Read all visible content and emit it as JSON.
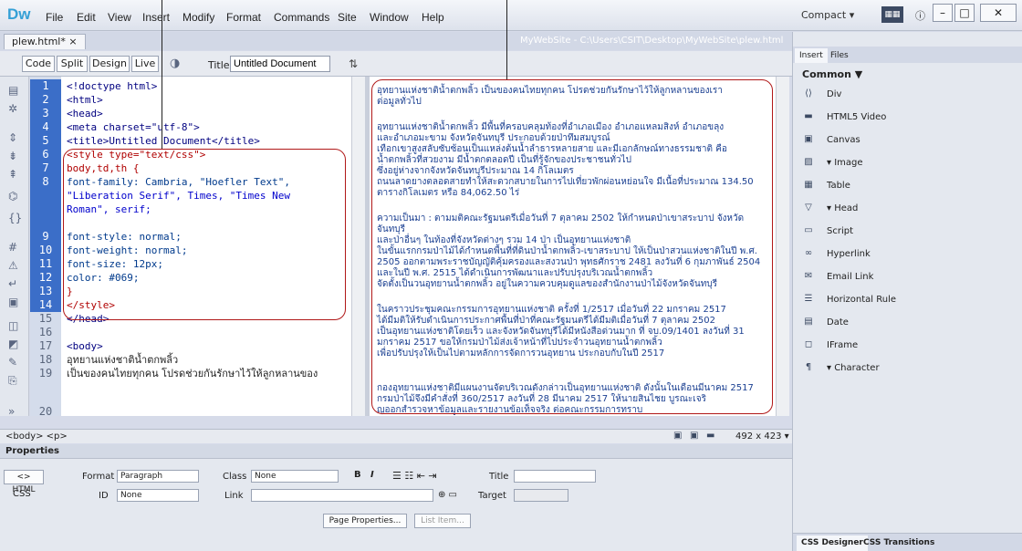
{
  "app": {
    "logo": "Dw",
    "workspace": "Compact ▾",
    "grid_icon": "grid-icon"
  },
  "menu": [
    "File",
    "Edit",
    "View",
    "Insert",
    "Modify",
    "Format",
    "Commands",
    "Site",
    "Window",
    "Help"
  ],
  "window_buttons": [
    "–",
    "□",
    "✕"
  ],
  "doc_tab": {
    "label": "plew.html* ×"
  },
  "doc_path": "MyWebSite - C:\\Users\\CSIT\\Desktop\\MyWebSite\\plew.html",
  "view_buttons": [
    "Code",
    "Split",
    "Design",
    "Live"
  ],
  "title_label": "Title:",
  "title_value": "Untitled Document",
  "line_numbers": [
    "1",
    "2",
    "3",
    "4",
    "5",
    "6",
    "7",
    "8",
    "",
    "",
    "9",
    "10",
    "11",
    "12",
    "13",
    "14",
    "15",
    "16",
    "17",
    "18",
    "19",
    "",
    "20"
  ],
  "code_lines": [
    "<!doctype html>",
    "<html>",
    "<head>",
    "<meta charset=\"utf-8\">",
    "<title>Untitled Document</title>",
    "<style type=\"text/css\">",
    "body,td,th {",
    "    font-family: Cambria, \"Hoefler Text\",",
    "\"Liberation Serif\", Times, \"Times New",
    "Roman\", serif;",
    "    font-style: normal;",
    "    font-weight: normal;",
    "    font-size: 12px;",
    "    color: #069;",
    "}",
    "</style>",
    "</head>",
    "",
    "<body>",
    "อุทยานแห่งชาติน้ำตกพลิ้ว",
    "เป็นของคนไทยทุกคน  โปรดช่วยกันรักษาไว้ให้ลูกหลานของ"
  ],
  "design_paragraphs": [
    [
      "อุทยานแห่งชาติน้ำตกพลิ้ว เป็นของคนไทยทุกคน โปรดช่วยกันรักษาไว้ให้ลูกหลานของเรา",
      "ต่อมูลทั่วไป"
    ],
    [
      "อุทยานแห่งชาติน้ำตกพลิ้ว มีพื้นที่ครอบคลุมท้องที่อำเภอเมือง อำเภอแหลมสิงห์ อำเภอขลุง",
      "และอำเภอมะขาม จังหวัดจันทบุรี ประกอบด้วยป่าทึมสมบูรณ์",
      "เทือกเขาสูงสลับซับซ้อนเป็นแหล่งต้นน้ำลำธารหลายสาย และมีเอกลักษณ์ทางธรรมชาติ คือ",
      "น้ำตกพลิ้วที่สวยงาม มีน้ำตกตลอดปี เป็นที่รู้จักของประชาชนทั่วไป",
      "ซึ่งอยู่ห่างจากจังหวัดจันทบุรีประมาณ 14 กิโลเมตร",
      "ถนนลาดยางตลอดสายทำให้สะดวกสบายในการไปเที่ยวพักผ่อนหย่อนใจ มีเนื้อที่ประมาณ 134.50",
      "ตารางกิโลเมตร หรือ 84,062.50 ไร่"
    ],
    [
      "ความเป็นมา : ตามมติคณะรัฐมนตรีเมื่อวันที่ 7 ตุลาคม 2502 ให้กำหนดป่าเขาสระบาป จังหวัดจันทบุรี",
      "และป่าอื่นๆ ในท้องที่จังหวัดต่างๆ รวม 14 ป่า เป็นอุทยานแห่งชาติ",
      "ในขั้นแรกกรมป่าไม้ได้กำหนดพื้นที่ที่ดินป่าน้ำตกพลิ้ว-เขาสระบาป ให้เป็นป่าสวนแห่งชาติในปี พ.ศ.",
      "2505 ออกตามพระราชบัญญัติคุ้มครองและสงวนป่า พุทธศักราช 2481 ลงวันที่ 6 กุมภาพันธ์ 2504",
      "และในปี พ.ศ. 2515 ได้ดำเนินการพัฒนาและปรับปรุงบริเวณน้ำตกพลิ้ว",
      "จัดตั้งเป็นวนอุทยานน้ำตกพลิ้ว อยู่ในความควบคุมดูแลของสำนักงานป่าไม้จังหวัดจันทบุรี"
    ],
    [
      "ในคราวประชุมคณะกรรมการอุทยานแห่งชาติ ครั้งที่ 1/2517 เมื่อวันที่ 22 มกราคม 2517",
      "ได้มีมติให้รับดำเนินการประกาศพื้นที่ป่าที่คณะรัฐมนตรีได้มีมติเมื่อวันที่ 7 ตุลาคม 2502",
      "เป็นอุทยานแห่งชาติโดยเร็ว และจังหวัดจันทบุรีได้มีหนังสือด่วนมาก ที่ จบ.09/1401 ลงวันที่ 31",
      "มกราคม 2517 ขอให้กรมป่าไม้ส่งเจ้าหน้าที่ไปประจำวนอุทยานน้ำตกพลิ้ว",
      "เพื่อปรับปรุงให้เป็นไปตามหลักการจัดการวนอุทยาน ประกอบกับในปี 2517"
    ],
    [
      "กองอุทยานแห่งชาติมีแผนงานจัดบริเวณดังกล่าวเป็นอุทยานแห่งชาติ ดังนั้นในเดือนมีนาคม 2517",
      "กรมป่าไม้จึงมีคำสั่งที่ 360/2517 ลงวันที่ 28 มีนาคม 2517 ให้นายสินไชย บูรณะเจริ",
      "ญออกสำรวจหาข้อมูลและรายงานข้อเท็จจริง ต่อคณะกรรมการทราบ"
    ]
  ],
  "status": {
    "tag_path": "<body> <p>",
    "size": "492 x 423 ▾"
  },
  "properties": {
    "header": "Properties",
    "html_btn": "<> HTML",
    "css_btn": "CSS",
    "format_label": "Format",
    "format_value": "Paragraph",
    "class_label": "Class",
    "class_value": "None",
    "id_label": "ID",
    "id_value": "None",
    "link_label": "Link",
    "title_label": "Title",
    "target_label": "Target",
    "bold": "B",
    "italic": "I",
    "page_properties": "Page Properties...",
    "list_item": "List Item..."
  },
  "right_panel": {
    "tabs": [
      "Insert",
      "Files"
    ],
    "category": "Common ▼",
    "items": [
      {
        "icon": "div-icon",
        "label": "Div"
      },
      {
        "icon": "video-icon",
        "label": "HTML5 Video"
      },
      {
        "icon": "canvas-icon",
        "label": "Canvas"
      },
      {
        "icon": "image-icon",
        "label": "▾ Image"
      },
      {
        "icon": "table-icon",
        "label": "Table"
      },
      {
        "icon": "head-icon",
        "label": "▾ Head"
      },
      {
        "icon": "script-icon",
        "label": "Script"
      },
      {
        "icon": "hyperlink-icon",
        "label": "Hyperlink"
      },
      {
        "icon": "email-icon",
        "label": "Email Link"
      },
      {
        "icon": "rule-icon",
        "label": "Horizontal Rule"
      },
      {
        "icon": "date-icon",
        "label": "Date"
      },
      {
        "icon": "iframe-icon",
        "label": "IFrame"
      },
      {
        "icon": "character-icon",
        "label": "▾ Character"
      }
    ],
    "bottom_tabs": [
      "CSS Designer",
      "CSS Transitions"
    ]
  }
}
